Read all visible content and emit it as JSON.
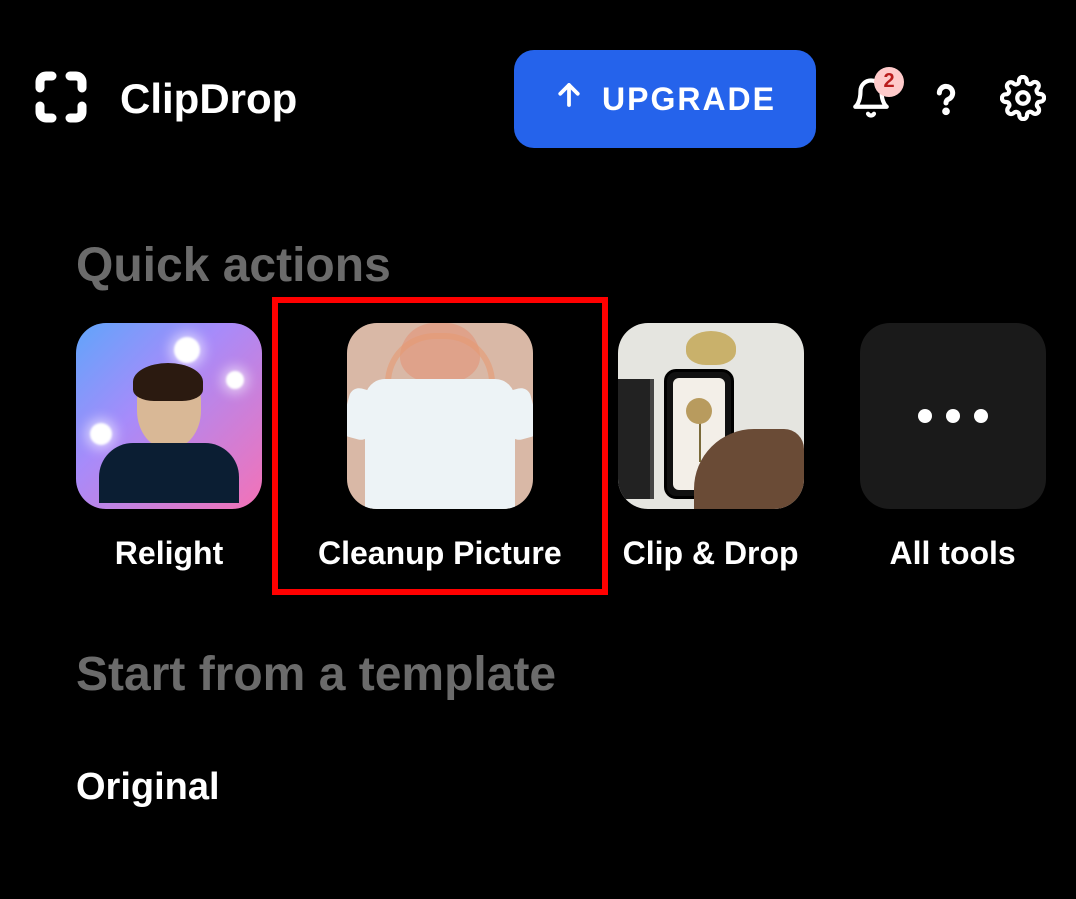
{
  "app": {
    "title": "ClipDrop"
  },
  "header": {
    "upgrade_label": "UPGRADE",
    "notification_count": "2"
  },
  "sections": {
    "quick_actions_title": "Quick actions",
    "template_title": "Start from a template"
  },
  "actions": [
    {
      "label": "Relight"
    },
    {
      "label": "Cleanup Picture"
    },
    {
      "label": "Clip & Drop"
    },
    {
      "label": "All tools"
    }
  ],
  "templates": [
    {
      "label": "Original"
    }
  ]
}
